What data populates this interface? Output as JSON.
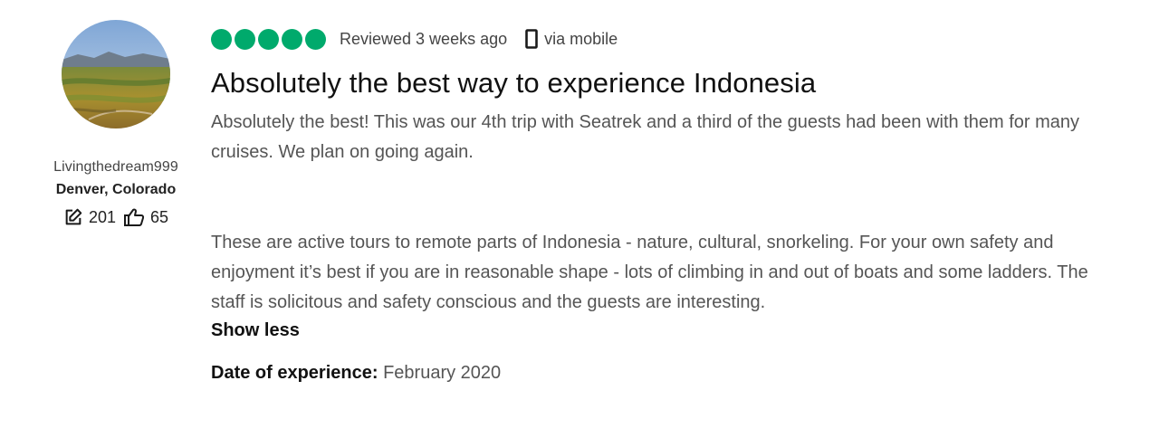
{
  "reviewer": {
    "username": "Livingthedream999",
    "location": "Denver, Colorado",
    "contributions": "201",
    "helpful_votes": "65",
    "contributions_icon": "edit-icon",
    "helpful_icon": "thumbs-up-icon"
  },
  "review": {
    "rating": 5,
    "rating_max": 5,
    "rating_color": "#00aa6c",
    "reviewed_text": "Reviewed 3 weeks ago",
    "via_text": "via mobile",
    "via_icon": "mobile-phone-icon",
    "title": "Absolutely the best way to experience Indonesia",
    "paragraphs": [
      "Absolutely the best! This was our 4th trip with Seatrek and a third of the guests had been with them for many cruises. We plan on going again.",
      "These are active tours to remote parts of Indonesia - nature, cultural, snorkeling. For your own safety and enjoyment it’s best if you are in reasonable shape - lots of climbing in and out of boats and some ladders. The staff is solicitous and safety conscious and the guests are interesting."
    ],
    "show_less_label": "Show less",
    "experience_label": "Date of experience:",
    "experience_date": "February 2020"
  }
}
